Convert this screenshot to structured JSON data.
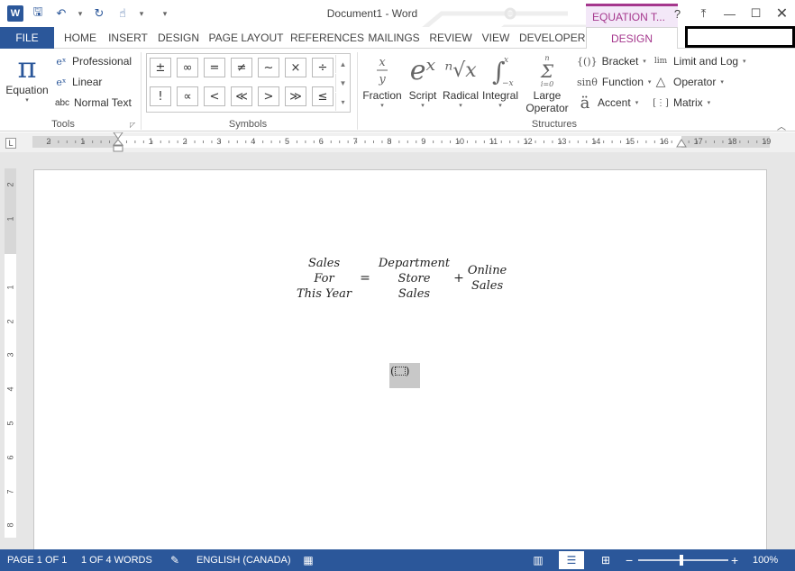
{
  "title_bar": {
    "doc_title": "Document1 - Word",
    "contextual_tab_group": "EQUATION T...",
    "help": "?",
    "ribbon_display": "⤒",
    "minimize": "—",
    "restore": "☐",
    "close": "✕"
  },
  "quick_access": {
    "app_logo": "W",
    "save": "🖫",
    "undo": "↶",
    "redo": "↻",
    "touch": "☝",
    "customize": "▾"
  },
  "tabs": [
    "FILE",
    "HOME",
    "INSERT",
    "DESIGN",
    "PAGE LAYOUT",
    "REFERENCES",
    "MAILINGS",
    "REVIEW",
    "VIEW",
    "DEVELOPER",
    "DESIGN"
  ],
  "ribbon": {
    "tools": {
      "group_label": "Tools",
      "equation": {
        "icon": "π",
        "label": "Equation"
      },
      "items": [
        {
          "icon": "eˣ",
          "label": "Professional"
        },
        {
          "icon": "eˣ",
          "label": "Linear"
        },
        {
          "icon": "abc",
          "label": "Normal Text"
        }
      ]
    },
    "symbols": {
      "group_label": "Symbols",
      "row1": [
        "±",
        "∞",
        "=",
        "≠",
        "~",
        "×",
        "÷"
      ],
      "row2": [
        "!",
        "∝",
        "<",
        "≪",
        ">",
        "≫",
        "≤"
      ]
    },
    "structures": {
      "group_label": "Structures",
      "big": [
        {
          "label": "Fraction",
          "icon": "x/y"
        },
        {
          "label": "Script",
          "icon": "eˣ"
        },
        {
          "label": "Radical",
          "icon": "ⁿ√x"
        },
        {
          "label": "Integral",
          "icon": "∫"
        },
        {
          "label": "Large Operator",
          "line1": "Large",
          "line2": "Operator",
          "icon": "Σ"
        }
      ],
      "list1": [
        {
          "icon": "{()}",
          "label": "Bracket"
        },
        {
          "icon": "sinθ",
          "label": "Function"
        },
        {
          "icon": "ä",
          "label": "Accent"
        }
      ],
      "list2": [
        {
          "icon": "lim",
          "label": "Limit and Log"
        },
        {
          "icon": "△",
          "label": "Operator"
        },
        {
          "icon": "[⋮]",
          "label": "Matrix"
        }
      ]
    }
  },
  "ruler": {
    "h_labels": [
      "2",
      "1",
      "1",
      "2",
      "3",
      "4",
      "5",
      "6",
      "7",
      "8",
      "9",
      "10",
      "11",
      "12",
      "13",
      "14",
      "15",
      "16",
      "17",
      "18",
      "19"
    ],
    "v_labels": [
      "2",
      "1",
      "1",
      "2",
      "3",
      "4",
      "5",
      "6",
      "7",
      "8"
    ]
  },
  "document": {
    "equation": {
      "lhs": [
        "Sales",
        "For",
        "This Year"
      ],
      "equals": "=",
      "term1": [
        "Department",
        "Store",
        "Sales"
      ],
      "plus": "+",
      "term2": [
        "Online",
        "Sales"
      ]
    },
    "placeholder": {
      "left": "(",
      "right": ")"
    }
  },
  "status_bar": {
    "page": "PAGE 1 OF 1",
    "words": "1 OF 4 WORDS",
    "language": "ENGLISH (CANADA)",
    "zoom_out": "−",
    "zoom_in": "+",
    "zoom": "100%"
  },
  "colors": {
    "accent": "#2b579a",
    "contextual": "#a5378d"
  }
}
